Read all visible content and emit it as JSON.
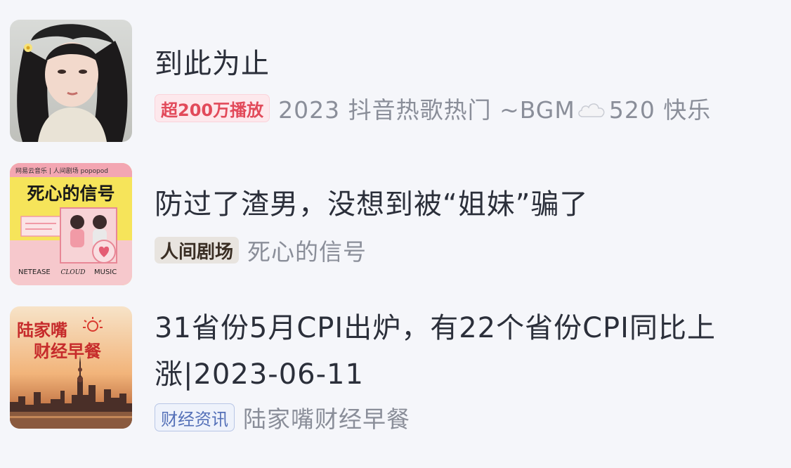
{
  "items": [
    {
      "title": "到此为止",
      "tag": "超200万播放",
      "subtitle_before": "2023 抖音热歌热门 ~BGM",
      "subtitle_icon": "cloud-emoji-icon",
      "subtitle_after": "520 快乐",
      "cover": "portrait-girl-cover"
    },
    {
      "title": "防过了渣男，没想到被“姐妹”骗了",
      "tag": "人间剧场",
      "subtitle": "死心的信号",
      "cover": {
        "name": "death-heart-signal-cover",
        "header": "网易云音乐 | 人间剧场  popopod",
        "headline": "死心的信号",
        "footer_left": "NETEASE",
        "footer_mid": "CLOUD",
        "footer_right": "MUSIC"
      }
    },
    {
      "title_line1": "31省份5月CPI出炉，有22个省份CPI同比上",
      "title_line2": "涨|2023-06-11",
      "tag": "财经资讯",
      "subtitle": "陆家嘴财经早餐",
      "cover": {
        "name": "lujiazui-skyline-cover",
        "line1": "陆家嘴",
        "line2": "财经早餐"
      }
    }
  ],
  "colors": {
    "background": "#f5f6fa",
    "title": "#2b2f3a",
    "subtext": "#8a8e99",
    "hot_tag": "#e24a5a",
    "finance_tag": "#5470b8"
  }
}
